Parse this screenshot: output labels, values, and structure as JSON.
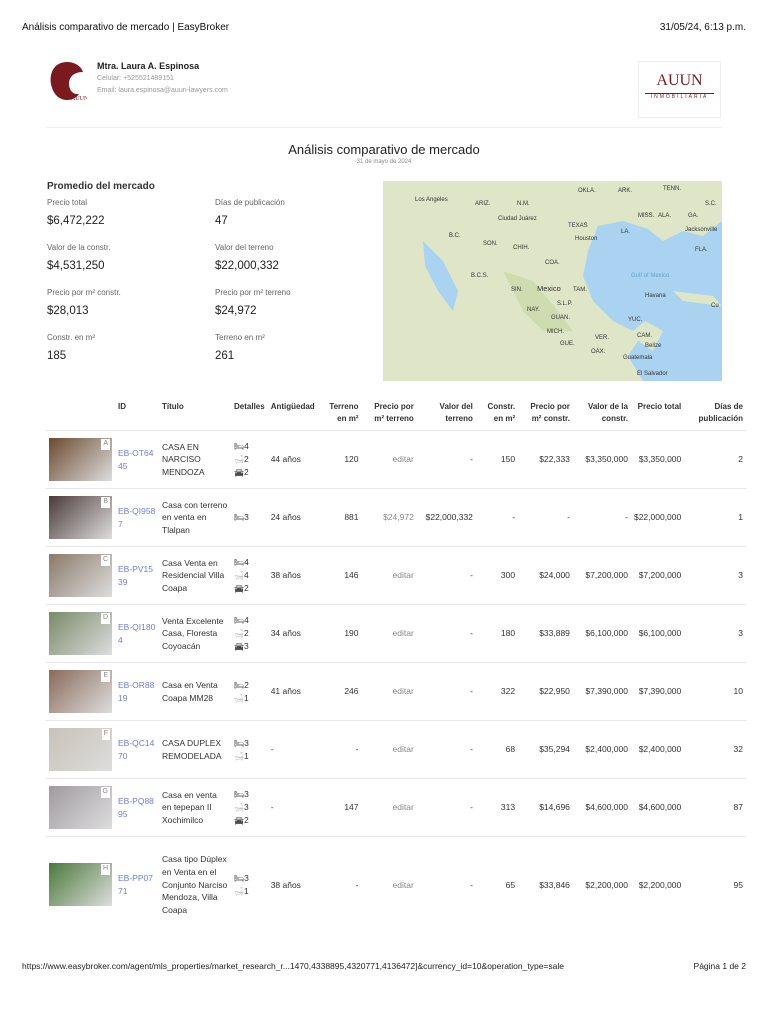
{
  "print_header": {
    "title": "Análisis comparativo de mercado | EasyBroker",
    "datetime": "31/05/24, 6:13 p.m."
  },
  "agent": {
    "name": "Mtra. Laura A. Espinosa",
    "phone": "Celular: +525521489151",
    "email": "Email: laura.espinosa@auun-lawyers.com",
    "logo_text": "AUUN",
    "brand_logo_text": "AUUN",
    "brand_logo_sub": "INMOBILIARIA"
  },
  "report": {
    "title": "Análisis comparativo de mercado",
    "date": "31 de mayo de 2024"
  },
  "summary": {
    "heading": "Promedio del mercado",
    "items": [
      {
        "label": "Precio total",
        "value": "$6,472,222"
      },
      {
        "label": "Días de publicación",
        "value": "47"
      },
      {
        "label": "Valor de la constr.",
        "value": "$4,531,250"
      },
      {
        "label": "Valor del terreno",
        "value": "$22,000,332"
      },
      {
        "label": "Precio por m² constr.",
        "value": "$28,013"
      },
      {
        "label": "Precio por m² terreno",
        "value": "$24,972"
      },
      {
        "label": "Constr. en m²",
        "value": "185"
      },
      {
        "label": "Terreno en m²",
        "value": "261"
      }
    ]
  },
  "map": {
    "labels": [
      "OKLA.",
      "ARK.",
      "TENN.",
      "Los Angeles",
      "ARIZ.",
      "N.M.",
      "MISS.",
      "ALA.",
      "GA.",
      "S.C.",
      "Ciudad Juárez",
      "TEXAS",
      "Houston",
      "LA.",
      "Jacksonville",
      "B.C.",
      "SON.",
      "CHIH.",
      "FLA.",
      "COA.",
      "Gulf of Mexico",
      "B.C.S.",
      "SIN.",
      "Mexico",
      "TAM.",
      "Havana",
      "Cu",
      "NAY.",
      "S.L.P.",
      "GUAN.",
      "YUC.",
      "MICH.",
      "GUE.",
      "OAX.",
      "CAM.",
      "VER.",
      "Belize",
      "Guatemala",
      "El Salvador"
    ]
  },
  "table": {
    "headers": [
      "",
      "ID",
      "Título",
      "Detalles",
      "Antigüedad",
      "Terreno en m²",
      "Precio por m² terreno",
      "Valor del terreno",
      "Constr. en m²",
      "Precio por m² constr.",
      "Valor de la constr.",
      "Precio total",
      "Días de publicación"
    ],
    "rows": [
      {
        "letter": "A",
        "id": "EB-OT6445",
        "title": "CASA EN NARCISO MENDOZA",
        "beds": "4",
        "baths": "2",
        "parking": "2",
        "age": "44 años",
        "land": "120",
        "land_ppm": "editar",
        "land_value": "-",
        "constr": "150",
        "constr_ppm": "$22,333",
        "constr_value": "$3,350,000",
        "total": "$3,350,000",
        "days": "2"
      },
      {
        "letter": "B",
        "id": "EB-QI9587",
        "title": "Casa con terreno en venta en Tlalpan",
        "beds": "3",
        "baths": "",
        "parking": "",
        "age": "24 años",
        "land": "881",
        "land_ppm": "$24,972",
        "land_value": "$22,000,332",
        "constr": "-",
        "constr_ppm": "-",
        "constr_value": "-",
        "total": "$22,000,000",
        "days": "1"
      },
      {
        "letter": "C",
        "id": "EB-PV1539",
        "title": "Casa Venta en Residencial Villa Coapa",
        "beds": "4",
        "baths": "4",
        "parking": "2",
        "age": "38 años",
        "land": "146",
        "land_ppm": "editar",
        "land_value": "-",
        "constr": "300",
        "constr_ppm": "$24,000",
        "constr_value": "$7,200,000",
        "total": "$7,200,000",
        "days": "3"
      },
      {
        "letter": "D",
        "id": "EB-QI1804",
        "title": "Venta Excelente Casa, Floresta Coyoacán",
        "beds": "4",
        "baths": "2",
        "parking": "3",
        "age": "34 años",
        "land": "190",
        "land_ppm": "editar",
        "land_value": "-",
        "constr": "180",
        "constr_ppm": "$33,889",
        "constr_value": "$6,100,000",
        "total": "$6,100,000",
        "days": "3"
      },
      {
        "letter": "E",
        "id": "EB-OR8819",
        "title": "Casa en Venta Coapa MM28",
        "beds": "2",
        "baths": "1",
        "parking": "",
        "age": "41 años",
        "land": "246",
        "land_ppm": "editar",
        "land_value": "-",
        "constr": "322",
        "constr_ppm": "$22,950",
        "constr_value": "$7,390,000",
        "total": "$7,390,000",
        "days": "10"
      },
      {
        "letter": "F",
        "id": "EB-QC1470",
        "title": "CASA DUPLEX REMODELADA",
        "beds": "3",
        "baths": "1",
        "parking": "",
        "age": "-",
        "land": "-",
        "land_ppm": "editar",
        "land_value": "-",
        "constr": "68",
        "constr_ppm": "$35,294",
        "constr_value": "$2,400,000",
        "total": "$2,400,000",
        "days": "32"
      },
      {
        "letter": "G",
        "id": "EB-PQ8895",
        "title": "Casa en venta en tepepan II Xochimilco",
        "beds": "3",
        "baths": "3",
        "parking": "2",
        "age": "-",
        "land": "147",
        "land_ppm": "editar",
        "land_value": "-",
        "constr": "313",
        "constr_ppm": "$14,696",
        "constr_value": "$4,600,000",
        "total": "$4,600,000",
        "days": "87"
      },
      {
        "letter": "H",
        "id": "EB-PP0771",
        "title": "Casa tipo Dúplex en Venta en el Conjunto Narciso Mendoza, Villa Coapa",
        "beds": "3",
        "baths": "1",
        "parking": "",
        "age": "38 años",
        "land": "-",
        "land_ppm": "editar",
        "land_value": "-",
        "constr": "65",
        "constr_ppm": "$33,846",
        "constr_value": "$2,200,000",
        "total": "$2,200,000",
        "days": "95"
      }
    ]
  },
  "print_footer": {
    "url": "https://www.easybroker.com/agent/mls_properties/market_research_r...1470,4338895,4320771,4136472]&currency_id=10&operation_type=sale",
    "page": "Página 1 de 2"
  },
  "colors": {
    "brand": "#7a1a1f",
    "link": "#6b7fd6",
    "water": "#a9d3f0",
    "land": "#dfe6c8"
  }
}
